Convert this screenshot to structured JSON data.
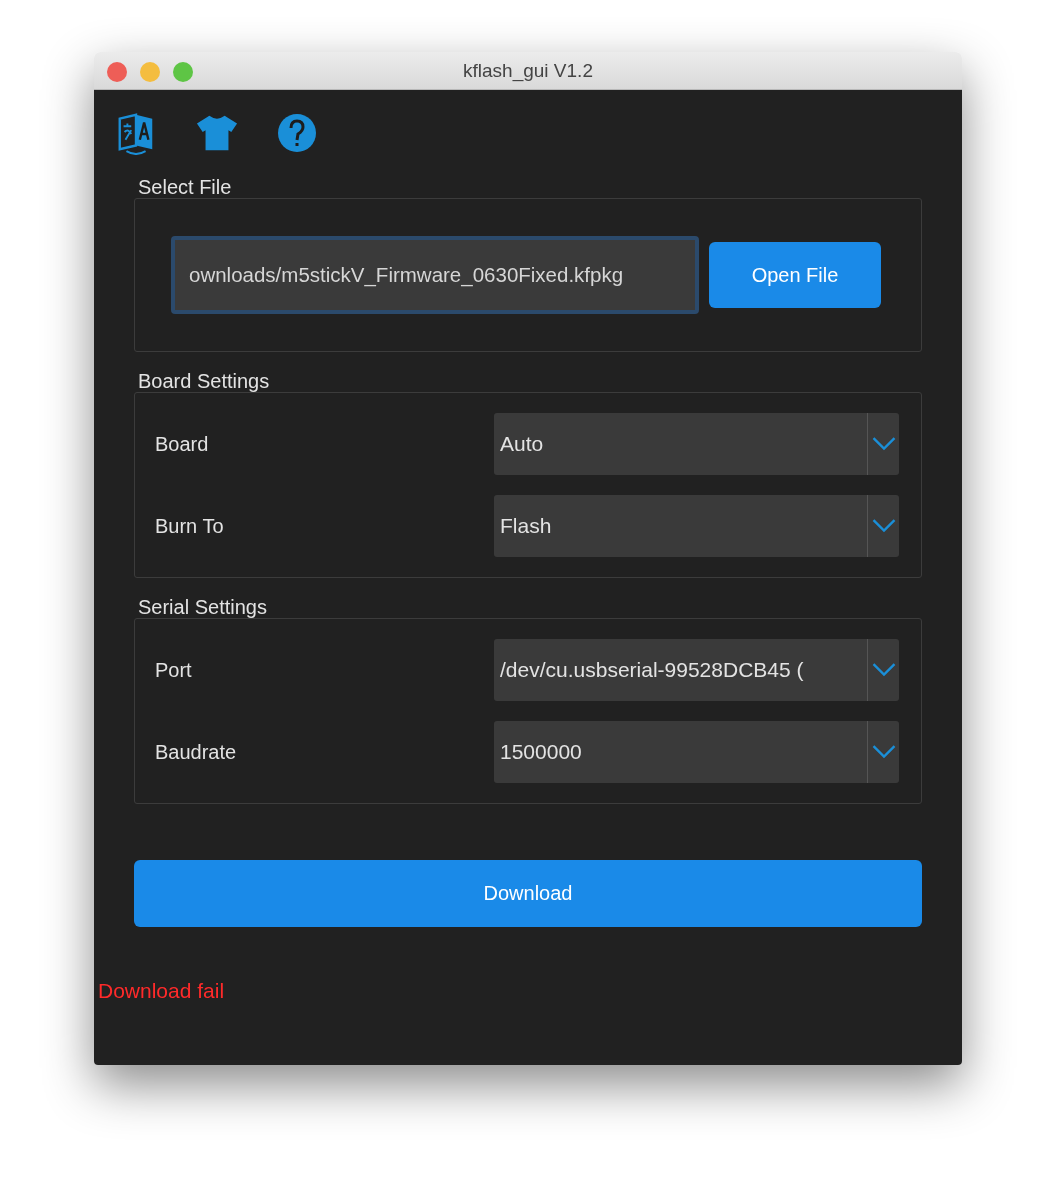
{
  "window": {
    "title": "kflash_gui V1.2"
  },
  "select_file": {
    "title": "Select File",
    "path": "ownloads/m5stickV_Firmware_0630Fixed.kfpkg",
    "button": "Open File"
  },
  "board_settings": {
    "title": "Board Settings",
    "rows": [
      {
        "label": "Board",
        "value": "Auto"
      },
      {
        "label": "Burn To",
        "value": "Flash"
      }
    ]
  },
  "serial_settings": {
    "title": "Serial Settings",
    "rows": [
      {
        "label": "Port",
        "value": "/dev/cu.usbserial-99528DCB45 ("
      },
      {
        "label": "Baudrate",
        "value": "1500000"
      }
    ]
  },
  "download_button": "Download",
  "status": {
    "text": "Download fail",
    "kind": "error"
  }
}
